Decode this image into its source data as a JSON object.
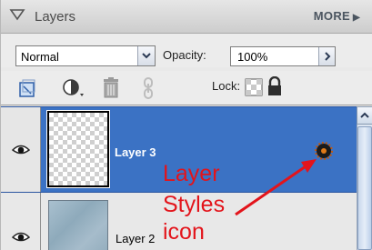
{
  "panel": {
    "title": "Layers",
    "more_label": "MORE",
    "more_arrow": "▶"
  },
  "options": {
    "blend_mode": "Normal",
    "opacity_label": "Opacity:",
    "opacity_value": "100%"
  },
  "toolbar": {
    "lock_label": "Lock:"
  },
  "layers": [
    {
      "name": "Layer 3",
      "selected": true,
      "visible": true,
      "has_styles": true
    },
    {
      "name": "Layer 2",
      "selected": false,
      "visible": true,
      "has_styles": false
    }
  ],
  "annotation": {
    "lines": [
      "Layer",
      "Styles",
      "icon"
    ],
    "color": "#e3141b"
  },
  "colors": {
    "selection": "#3b72c4",
    "panel_bg": "#e9e9e9"
  }
}
